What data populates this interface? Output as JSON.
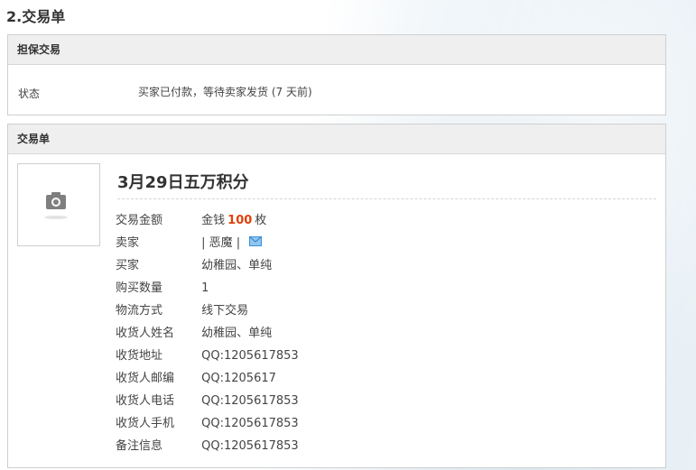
{
  "page": {
    "title": "2.交易单"
  },
  "guarantee": {
    "header": "担保交易",
    "status_label": "状态",
    "status_value": "买家已付款，等待卖家发货 (7 天前)"
  },
  "order": {
    "header": "交易单",
    "item_title": "3月29日五万积分",
    "fields": {
      "amount_label": "交易金额",
      "amount_prefix": "金钱",
      "amount_value": "100",
      "amount_unit": "枚",
      "seller_label": "卖家",
      "seller_value": "| 恶魔 |",
      "buyer_label": "买家",
      "buyer_value": "幼稚园、单纯",
      "quantity_label": "购买数量",
      "quantity_value": "1",
      "shipping_label": "物流方式",
      "shipping_value": "线下交易",
      "receiver_name_label": "收货人姓名",
      "receiver_name_value": "幼稚园、单纯",
      "address_label": "收货地址",
      "address_value": "QQ:1205617853",
      "postcode_label": "收货人邮编",
      "postcode_value": "QQ:1205617",
      "phone_label": "收货人电话",
      "phone_value": "QQ:1205617853",
      "mobile_label": "收货人手机",
      "mobile_value": "QQ:1205617853",
      "note_label": "备注信息",
      "note_value": "QQ:1205617853"
    },
    "icons": {
      "thumbnail": "camera-icon",
      "seller_message": "mail-icon"
    },
    "colors": {
      "amount": "#e0400b"
    }
  }
}
